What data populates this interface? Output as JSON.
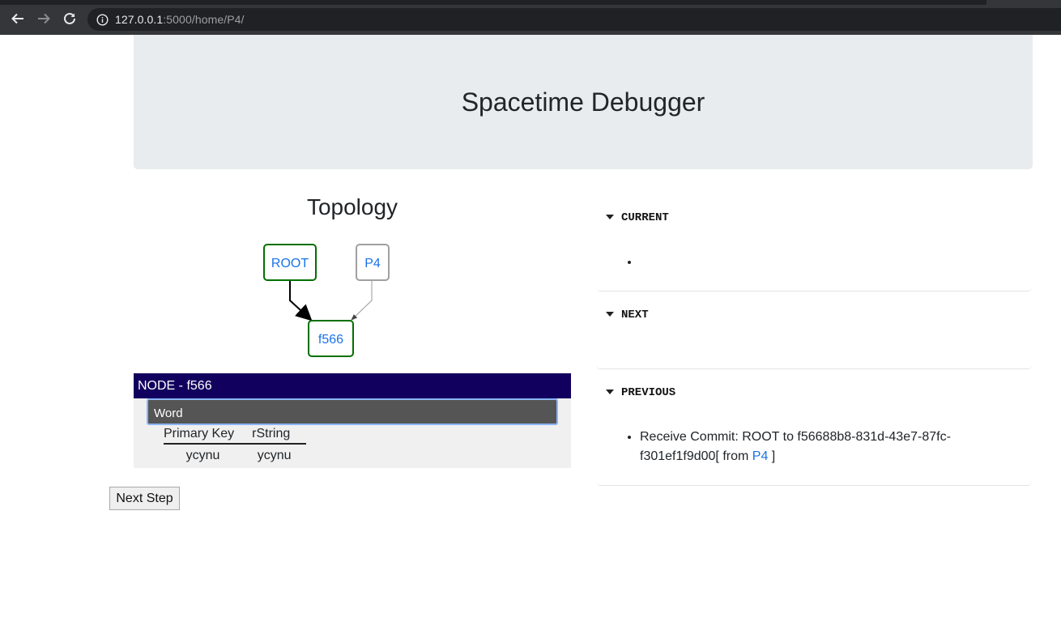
{
  "browser": {
    "url_host": "127.0.0.1",
    "url_rest": ":5000/home/P4/"
  },
  "page": {
    "title": "Spacetime Debugger"
  },
  "topology": {
    "title": "Topology",
    "nodes": {
      "root": "ROOT",
      "p4": "P4",
      "f566": "f566"
    }
  },
  "node_panel": {
    "header": "NODE - f566",
    "type_name": "Word",
    "columns": [
      "Primary Key",
      "rString"
    ],
    "rows": [
      [
        "ycynu",
        "ycynu"
      ]
    ]
  },
  "controls": {
    "next_step": "Next Step"
  },
  "sections": {
    "current": {
      "label": "CURRENT",
      "items": [
        ""
      ]
    },
    "next": {
      "label": "NEXT"
    },
    "previous": {
      "label": "PREVIOUS",
      "item_text": "Receive Commit: ROOT to f56688b8-831d-43e7-87fc-f301ef1f9d00[ from ",
      "item_link": "P4",
      "item_suffix": " ]"
    }
  },
  "colors": {
    "header_bg": "#12005e",
    "node_green": "#007000",
    "node_grey": "#a0a0a0",
    "link_blue": "#1a73e8"
  }
}
